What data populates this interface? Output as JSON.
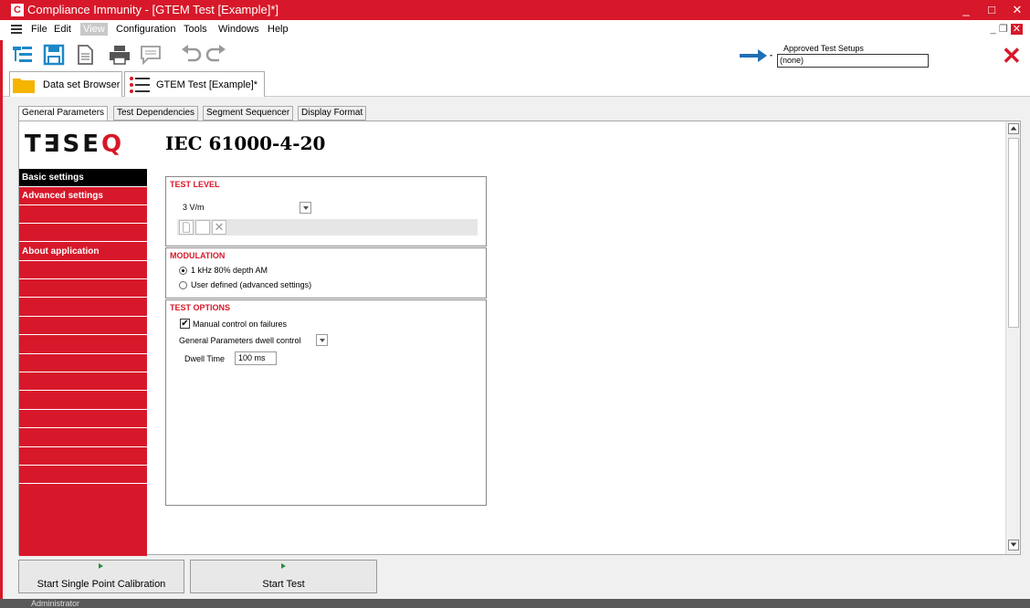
{
  "window": {
    "title": "Compliance Immunity - [GTEM Test [Example]*]",
    "minimize": "_",
    "maximize": "□",
    "close": "✕"
  },
  "menu": {
    "items": [
      "File",
      "Edit",
      "View",
      "Configuration",
      "Tools",
      "Windows",
      "Help"
    ],
    "mdi_min": "_",
    "mdi_restore": "❐",
    "mdi_close": "✕"
  },
  "toolbar": {
    "approved_label": "Approved Test Setups",
    "approved_value": "(none)"
  },
  "doc_tabs": {
    "browser": "Data set Browser",
    "test": "GTEM Test [Example]*"
  },
  "sub_tabs": [
    "General Parameters",
    "Test Dependencies",
    "Segment Sequencer",
    "Display Format"
  ],
  "header": {
    "logo_text": "T∃SE",
    "logo_o": "Q",
    "standard": "IEC 61000-4-20"
  },
  "nav": {
    "basic": "Basic settings",
    "advanced": "Advanced settings",
    "about": "About application"
  },
  "test_level": {
    "title": "TEST LEVEL",
    "value": "3 V/m"
  },
  "modulation": {
    "title": "MODULATION",
    "option1": "1 kHz 80% depth AM",
    "option2": "User defined (advanced settings)",
    "selected": 1
  },
  "test_options": {
    "title": "TEST OPTIONS",
    "manual_control": "Manual control on failures",
    "manual_checked": true,
    "dwell_control": "General Parameters dwell control",
    "dwell_label": "Dwell Time",
    "dwell_value": "100 ms"
  },
  "buttons": {
    "calibration": "Start Single Point Calibration",
    "start": "Start Test"
  },
  "status": {
    "user": "Administrator"
  },
  "colors": {
    "accent": "#d7182a",
    "arrow": "#1f6fb5"
  }
}
